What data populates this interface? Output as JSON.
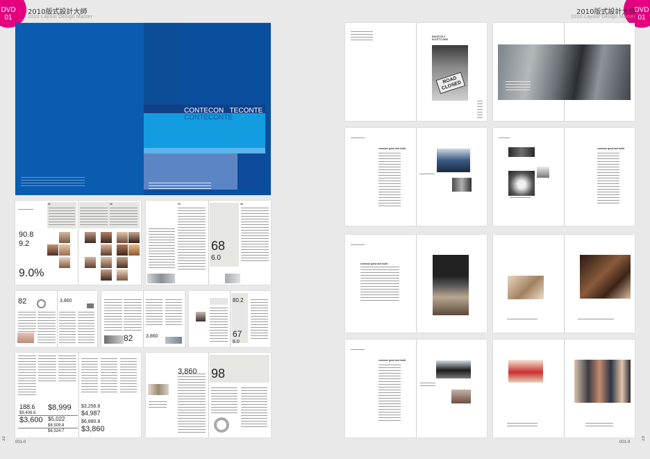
{
  "header": {
    "badge_top": "DVD",
    "badge_bottom": "01",
    "title": "2010版式設計大師",
    "subtitle": "2010 Layout Design Master"
  },
  "footer": {
    "left_page_number": "22",
    "right_page_number": "23",
    "left_code": "001-0",
    "right_code": "001-9"
  },
  "cover": {
    "title_line1_a": "CONTECON",
    "title_line1_b": "TECONTE",
    "title_line2": "CONTECONTE"
  },
  "spread1": {
    "num_a": "90.8",
    "num_b": "9.2",
    "num_c": "9.0%",
    "num_d": "68",
    "num_e": "6.0",
    "col1": "01",
    "col2": "02",
    "col3": "03",
    "col4": "03"
  },
  "spread2": {
    "num_a": "82",
    "num_b": "3,860",
    "num_c": "82",
    "num_d": "3,860",
    "num_e": "80.2",
    "num_f": "67",
    "num_g": "8.0"
  },
  "spread3": {
    "prices": [
      "188.6",
      "$9,408.6",
      "$3,600",
      "$8,999",
      "$5,022",
      "$8,509.8",
      "$6,324.7",
      "$3,256.8",
      "$4,987",
      "$6,880.8",
      "$3,860"
    ],
    "num_a": "3,860",
    "num_b": "98"
  },
  "right_pages": {
    "road_sign": "ROAD CLOSED",
    "heading_a": "RUGSTOLT SCUTTZ 2000",
    "heading_b": "common good and build"
  }
}
